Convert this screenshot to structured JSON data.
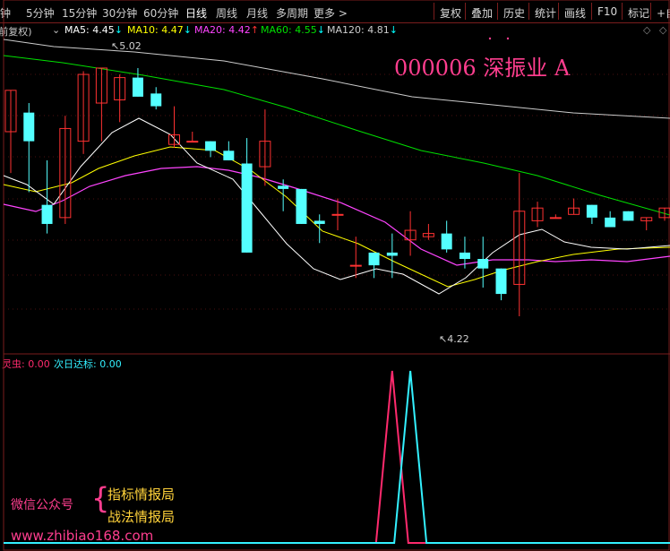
{
  "toolbar": {
    "periods": [
      "钟",
      "5分钟",
      "15分钟",
      "30分钟",
      "60分钟",
      "日线",
      "周线",
      "月线",
      "多周期",
      "更多 >"
    ],
    "active_period": "日线",
    "buttons": [
      "复权",
      "叠加",
      "历史",
      "统计",
      "画线",
      "F10",
      "标记",
      "+自"
    ]
  },
  "legend": {
    "adjust": "(前复权)",
    "ma5": "MA5: 4.45",
    "ma10": "MA10: 4.47",
    "ma20": "MA20: 4.42",
    "ma60": "MA60: 4.55",
    "ma120": "MA120: 4.81",
    "colors": {
      "ma5": "#ffffff",
      "ma10": "#ffff00",
      "ma20": "#ff44ff",
      "ma60": "#00e000",
      "ma120": "#cccccc",
      "down_arrow": "#00ffff",
      "up_arrow": "#ff3333"
    }
  },
  "stock": {
    "title": "000006 深振业 A"
  },
  "annotations": {
    "high": "5.02",
    "low": "4.22"
  },
  "indicator": {
    "label1": "灵虫: 0.00",
    "label2": "次日达标: 0.00",
    "series": [
      {
        "name": "灵虫",
        "color": "#ff2a6d",
        "spike_index": 21,
        "value": 1
      },
      {
        "name": "次日达标",
        "color": "#33f0ff",
        "spike_index": 22,
        "value": 1
      }
    ]
  },
  "watermark": {
    "left": "微信公众号",
    "right1": "指标情报局",
    "right2": "战法情报局",
    "url": "www.zhibiao168.com"
  },
  "chart_data": {
    "type": "candlestick",
    "price_range": [
      4.14,
      5.12
    ],
    "candles": [
      {
        "o": 4.83,
        "h": 4.93,
        "l": 4.7,
        "c": 4.96
      },
      {
        "o": 4.89,
        "h": 4.92,
        "l": 4.64,
        "c": 4.8
      },
      {
        "o": 4.6,
        "h": 4.74,
        "l": 4.51,
        "c": 4.54
      },
      {
        "o": 4.56,
        "h": 4.88,
        "l": 4.54,
        "c": 4.84
      },
      {
        "o": 4.8,
        "h": 5.02,
        "l": 4.76,
        "c": 5.01
      },
      {
        "o": 4.92,
        "h": 5.02,
        "l": 4.8,
        "c": 5.03
      },
      {
        "o": 4.93,
        "h": 5.01,
        "l": 4.86,
        "c": 5.0
      },
      {
        "o": 5.0,
        "h": 5.03,
        "l": 4.98,
        "c": 4.94
      },
      {
        "o": 4.95,
        "h": 4.97,
        "l": 4.9,
        "c": 4.91
      },
      {
        "o": 4.79,
        "h": 4.91,
        "l": 4.78,
        "c": 4.82
      },
      {
        "o": 4.8,
        "h": 4.83,
        "l": 4.8,
        "c": 4.8
      },
      {
        "o": 4.8,
        "h": 4.79,
        "l": 4.75,
        "c": 4.77
      },
      {
        "o": 4.77,
        "h": 4.8,
        "l": 4.77,
        "c": 4.74
      },
      {
        "o": 4.73,
        "h": 4.81,
        "l": 4.45,
        "c": 4.45
      },
      {
        "o": 4.72,
        "h": 4.9,
        "l": 4.66,
        "c": 4.8
      },
      {
        "o": 4.66,
        "h": 4.68,
        "l": 4.58,
        "c": 4.65
      },
      {
        "o": 4.65,
        "h": 4.62,
        "l": 4.54,
        "c": 4.54
      },
      {
        "o": 4.55,
        "h": 4.57,
        "l": 4.48,
        "c": 4.54
      },
      {
        "o": 4.57,
        "h": 4.62,
        "l": 4.52,
        "c": 4.57
      },
      {
        "o": 4.41,
        "h": 4.5,
        "l": 4.37,
        "c": 4.41
      },
      {
        "o": 4.45,
        "h": 4.43,
        "l": 4.37,
        "c": 4.41
      },
      {
        "o": 4.45,
        "h": 4.51,
        "l": 4.37,
        "c": 4.44
      },
      {
        "o": 4.49,
        "h": 4.58,
        "l": 4.44,
        "c": 4.52
      },
      {
        "o": 4.5,
        "h": 4.54,
        "l": 4.49,
        "c": 4.51
      },
      {
        "o": 4.51,
        "h": 4.55,
        "l": 4.45,
        "c": 4.46
      },
      {
        "o": 4.45,
        "h": 4.5,
        "l": 4.4,
        "c": 4.43
      },
      {
        "o": 4.43,
        "h": 4.5,
        "l": 4.34,
        "c": 4.4
      },
      {
        "o": 4.4,
        "h": 4.34,
        "l": 4.3,
        "c": 4.32
      },
      {
        "o": 4.35,
        "h": 4.7,
        "l": 4.25,
        "c": 4.58
      },
      {
        "o": 4.55,
        "h": 4.61,
        "l": 4.53,
        "c": 4.59
      },
      {
        "o": 4.56,
        "h": 4.57,
        "l": 4.56,
        "c": 4.56
      },
      {
        "o": 4.57,
        "h": 4.62,
        "l": 4.57,
        "c": 4.59
      },
      {
        "o": 4.6,
        "h": 4.6,
        "l": 4.54,
        "c": 4.56
      },
      {
        "o": 4.56,
        "h": 4.58,
        "l": 4.54,
        "c": 4.53
      },
      {
        "o": 4.58,
        "h": 4.58,
        "l": 4.55,
        "c": 4.55
      },
      {
        "o": 4.55,
        "h": 4.56,
        "l": 4.52,
        "c": 4.56
      },
      {
        "o": 4.56,
        "h": 4.59,
        "l": 4.55,
        "c": 4.59
      }
    ]
  }
}
